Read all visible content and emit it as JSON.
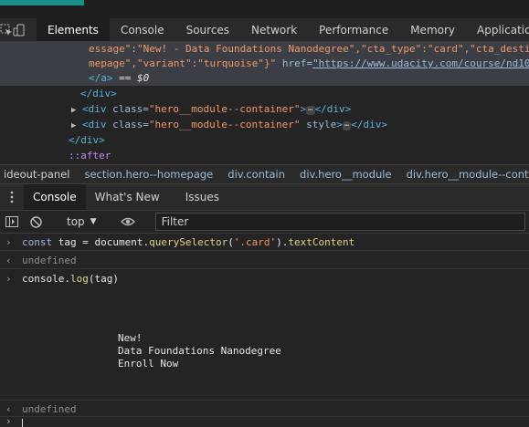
{
  "devtools": {
    "tabs": [
      "Elements",
      "Console",
      "Sources",
      "Network",
      "Performance",
      "Memory",
      "Application"
    ],
    "active_tab": "Elements"
  },
  "elements": {
    "line1": {
      "p1": "essage\":\"New! - Data Foundations Nanodegree\",\"cta_type\":\"card\",\"cta_desti"
    },
    "line2": {
      "p1": "mepage\",\"variant\":\"turquoise\"}\"",
      "href_attr": " href=",
      "href_val": "\"https://www.udacity.com/course/nd10"
    },
    "line3": {
      "tag": "</a>",
      "eq": " == $0"
    },
    "line4": "</div>",
    "line5": {
      "open": "<div ",
      "attr": "class=",
      "val": "\"hero__module--container\"",
      "close1": ">",
      "ellipsis": "⋯",
      "end": "</div>"
    },
    "line6": {
      "open": "<div ",
      "attr": "class=",
      "val": "\"hero__module--container\"",
      "style": " style",
      "close1": ">",
      "ellipsis": "⋯",
      "end": "</div>"
    },
    "line7": "</div>",
    "line8": "::after"
  },
  "breadcrumbs": [
    "ideout-panel",
    "section.hero--homepage",
    "div.contain",
    "div.hero__module",
    "div.hero__module--container"
  ],
  "drawer": {
    "tabs": [
      "Console",
      "What's New",
      "Issues"
    ],
    "active": "Console"
  },
  "toolbar": {
    "context": "top",
    "filter_placeholder": "Filter"
  },
  "console": {
    "cmd1": {
      "kw": "const",
      "rest1": " tag = document.",
      "fn": "querySelector",
      "paren": "(",
      "str": "'.card'",
      "rest2": ").",
      "prop": "textContent"
    },
    "res1": "undefined",
    "cmd2": {
      "a": "console.",
      "fn": "log",
      "b": "(tag)"
    },
    "output": [
      "New!",
      "Data Foundations Nanodegree",
      "Enroll Now"
    ],
    "res2": "undefined"
  },
  "icons": {
    "inspect": "inspect-element-icon",
    "device": "device-toolbar-icon",
    "menu": "menu-dots-icon",
    "sidebar": "sidebar-toggle-icon",
    "clear": "clear-console-icon",
    "eye": "live-expression-eye-icon"
  }
}
